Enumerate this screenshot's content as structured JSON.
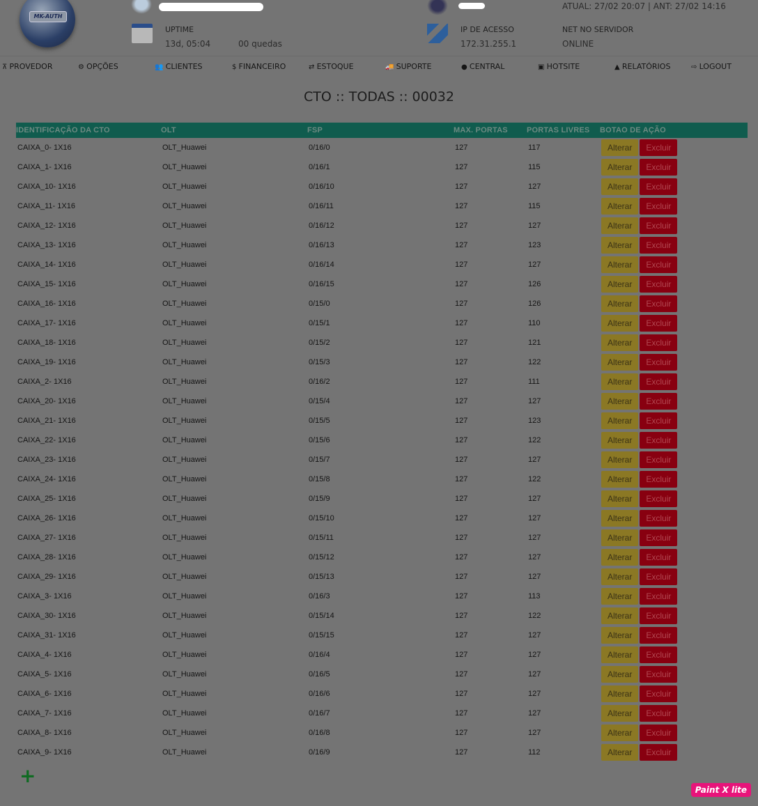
{
  "header": {
    "logo_text": "MK-AUTH",
    "uptime_label": "UPTIME",
    "uptime_value": "13d, 05:04",
    "quedas": "00 quedas",
    "ip_label": "IP DE ACESSO",
    "ip_value": "172.31.255.1",
    "net_label": "NET NO SERVIDOR",
    "net_value": "ONLINE",
    "login_times": "ATUAL: 27/02 20:07 | ANT: 27/02 14:16"
  },
  "nav": [
    {
      "icon": "sitemap-icon",
      "label": "PROVEDOR",
      "glyph": "⊼"
    },
    {
      "icon": "gears-icon",
      "label": "OPÇÕES",
      "glyph": "⚙"
    },
    {
      "icon": "users-icon",
      "label": "CLIENTES",
      "glyph": "👥"
    },
    {
      "icon": "dollar-icon",
      "label": "FINANCEIRO",
      "glyph": "$"
    },
    {
      "icon": "exchange-icon",
      "label": "ESTOQUE",
      "glyph": "⇄"
    },
    {
      "icon": "truck-icon",
      "label": "SUPORTE",
      "glyph": "🚚"
    },
    {
      "icon": "globe-icon",
      "label": "CENTRAL",
      "glyph": "●"
    },
    {
      "icon": "html5-icon",
      "label": "HOTSITE",
      "glyph": "▣"
    },
    {
      "icon": "area-chart-icon",
      "label": "RELATÓRIOS",
      "glyph": "▲"
    },
    {
      "icon": "sign-out-icon",
      "label": "LOGOUT",
      "glyph": "⇨"
    }
  ],
  "page_title": "CTO :: TODAS :: 00032",
  "table": {
    "headers": [
      "IDENTIFICAÇÃO DA CTO",
      "OLT",
      "FSP",
      "MAX. PORTAS",
      "PORTAS LIVRES",
      "BOTAO DE AÇÃO"
    ],
    "alter_label": "Alterar",
    "delete_label": "Excluir",
    "rows": [
      [
        "CAIXA_0- 1X16",
        "OLT_Huawei",
        "0/16/0",
        "127",
        "117"
      ],
      [
        "CAIXA_1- 1X16",
        "OLT_Huawei",
        "0/16/1",
        "127",
        "115"
      ],
      [
        "CAIXA_10- 1X16",
        "OLT_Huawei",
        "0/16/10",
        "127",
        "127"
      ],
      [
        "CAIXA_11- 1X16",
        "OLT_Huawei",
        "0/16/11",
        "127",
        "115"
      ],
      [
        "CAIXA_12- 1X16",
        "OLT_Huawei",
        "0/16/12",
        "127",
        "127"
      ],
      [
        "CAIXA_13- 1X16",
        "OLT_Huawei",
        "0/16/13",
        "127",
        "123"
      ],
      [
        "CAIXA_14- 1X16",
        "OLT_Huawei",
        "0/16/14",
        "127",
        "127"
      ],
      [
        "CAIXA_15- 1X16",
        "OLT_Huawei",
        "0/16/15",
        "127",
        "126"
      ],
      [
        "CAIXA_16- 1X16",
        "OLT_Huawei",
        "0/15/0",
        "127",
        "126"
      ],
      [
        "CAIXA_17- 1X16",
        "OLT_Huawei",
        "0/15/1",
        "127",
        "110"
      ],
      [
        "CAIXA_18- 1X16",
        "OLT_Huawei",
        "0/15/2",
        "127",
        "121"
      ],
      [
        "CAIXA_19- 1X16",
        "OLT_Huawei",
        "0/15/3",
        "127",
        "122"
      ],
      [
        "CAIXA_2- 1X16",
        "OLT_Huawei",
        "0/16/2",
        "127",
        "111"
      ],
      [
        "CAIXA_20- 1X16",
        "OLT_Huawei",
        "0/15/4",
        "127",
        "127"
      ],
      [
        "CAIXA_21- 1X16",
        "OLT_Huawei",
        "0/15/5",
        "127",
        "123"
      ],
      [
        "CAIXA_22- 1X16",
        "OLT_Huawei",
        "0/15/6",
        "127",
        "122"
      ],
      [
        "CAIXA_23- 1X16",
        "OLT_Huawei",
        "0/15/7",
        "127",
        "127"
      ],
      [
        "CAIXA_24- 1X16",
        "OLT_Huawei",
        "0/15/8",
        "127",
        "122"
      ],
      [
        "CAIXA_25- 1X16",
        "OLT_Huawei",
        "0/15/9",
        "127",
        "127"
      ],
      [
        "CAIXA_26- 1X16",
        "OLT_Huawei",
        "0/15/10",
        "127",
        "127"
      ],
      [
        "CAIXA_27- 1X16",
        "OLT_Huawei",
        "0/15/11",
        "127",
        "127"
      ],
      [
        "CAIXA_28- 1X16",
        "OLT_Huawei",
        "0/15/12",
        "127",
        "127"
      ],
      [
        "CAIXA_29- 1X16",
        "OLT_Huawei",
        "0/15/13",
        "127",
        "127"
      ],
      [
        "CAIXA_3- 1X16",
        "OLT_Huawei",
        "0/16/3",
        "127",
        "113"
      ],
      [
        "CAIXA_30- 1X16",
        "OLT_Huawei",
        "0/15/14",
        "127",
        "122"
      ],
      [
        "CAIXA_31- 1X16",
        "OLT_Huawei",
        "0/15/15",
        "127",
        "127"
      ],
      [
        "CAIXA_4- 1X16",
        "OLT_Huawei",
        "0/16/4",
        "127",
        "127"
      ],
      [
        "CAIXA_5- 1X16",
        "OLT_Huawei",
        "0/16/5",
        "127",
        "127"
      ],
      [
        "CAIXA_6- 1X16",
        "OLT_Huawei",
        "0/16/6",
        "127",
        "127"
      ],
      [
        "CAIXA_7- 1X16",
        "OLT_Huawei",
        "0/16/7",
        "127",
        "127"
      ],
      [
        "CAIXA_8- 1X16",
        "OLT_Huawei",
        "0/16/8",
        "127",
        "127"
      ],
      [
        "CAIXA_9- 1X16",
        "OLT_Huawei",
        "0/16/9",
        "127",
        "112"
      ]
    ]
  },
  "add_glyph": "+",
  "watermark": "Paint X lite"
}
